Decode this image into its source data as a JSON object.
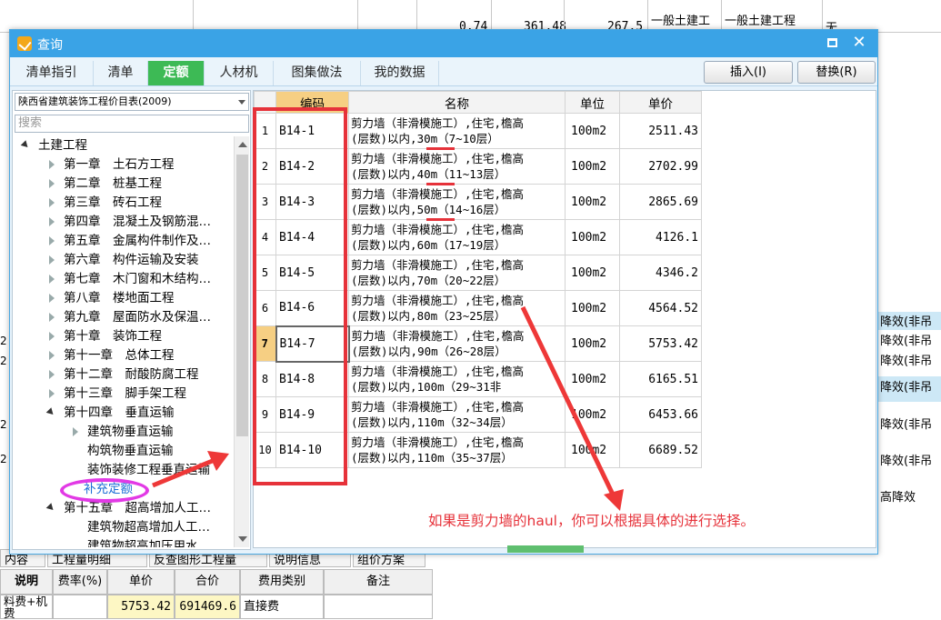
{
  "background": {
    "top_values": [
      "0.74",
      "361.48",
      "267.5",
      "一般土建工",
      "一般土建工程"
    ],
    "top_extra": "无",
    "right_rows": [
      "降效(非吊",
      "降效(非吊",
      "降效(非吊",
      "降效(非吊",
      "降效(非吊",
      "降效(非吊",
      "高降效"
    ],
    "left_digits": [
      "2",
      "2",
      "2",
      "2"
    ],
    "bottom_tabs": [
      "内容",
      "工程量明细",
      "反查图形工程量",
      "说明信息",
      "组价方案"
    ],
    "bottom_headers": [
      "说明",
      "费率(%)",
      "单价",
      "合价",
      "费用类别",
      "备注"
    ],
    "bottom_row": [
      "料费+机",
      "费",
      "5753.42",
      "691469.6",
      "直接费"
    ]
  },
  "dialog": {
    "title": "查询",
    "tabs": [
      "清单指引",
      "清单",
      "定额",
      "人材机",
      "图集做法",
      "我的数据"
    ],
    "active_tab": "定额",
    "insert_button": "插入(I)",
    "replace_button": "替换(R)"
  },
  "left_panel": {
    "library": "陕西省建筑装饰工程价目表(2009)",
    "search_placeholder": "搜索",
    "tree": [
      {
        "label": "土建工程",
        "level": 0,
        "state": "open"
      },
      {
        "label": "第一章　土石方工程",
        "level": 1,
        "state": "closed"
      },
      {
        "label": "第二章　桩基工程",
        "level": 1,
        "state": "closed"
      },
      {
        "label": "第三章　砖石工程",
        "level": 1,
        "state": "closed"
      },
      {
        "label": "第四章　混凝土及钢筋混…",
        "level": 1,
        "state": "closed"
      },
      {
        "label": "第五章　金属构件制作及…",
        "level": 1,
        "state": "closed"
      },
      {
        "label": "第六章　构件运输及安装",
        "level": 1,
        "state": "closed"
      },
      {
        "label": "第七章　木门窗和木结构…",
        "level": 1,
        "state": "closed"
      },
      {
        "label": "第八章　楼地面工程",
        "level": 1,
        "state": "closed"
      },
      {
        "label": "第九章　屋面防水及保温…",
        "level": 1,
        "state": "closed"
      },
      {
        "label": "第十章　装饰工程",
        "level": 1,
        "state": "closed"
      },
      {
        "label": "第十一章　总体工程",
        "level": 1,
        "state": "closed"
      },
      {
        "label": "第十二章　耐酸防腐工程",
        "level": 1,
        "state": "closed"
      },
      {
        "label": "第十三章　脚手架工程",
        "level": 1,
        "state": "closed"
      },
      {
        "label": "第十四章　垂直运输",
        "level": 1,
        "state": "open"
      },
      {
        "label": "建筑物垂直运输",
        "level": 2,
        "state": "closed"
      },
      {
        "label": "构筑物垂直运输",
        "level": 2,
        "state": "none"
      },
      {
        "label": "装饰装修工程垂直运输",
        "level": 2,
        "state": "none"
      },
      {
        "label": "补充定额",
        "level": 2,
        "state": "highlight"
      },
      {
        "label": "第十五章　超高增加人工…",
        "level": 1,
        "state": "open"
      },
      {
        "label": "建筑物超高增加人工…",
        "level": 2,
        "state": "none"
      },
      {
        "label": "建筑物超高加压用水…",
        "level": 2,
        "state": "none"
      }
    ]
  },
  "grid": {
    "headers": [
      "",
      "编码",
      "名称",
      "单位",
      "单价"
    ],
    "rows": [
      {
        "num": "1",
        "code": "B14-1",
        "name1": "剪力墙（非滑模施工）,住宅,檐高",
        "name2": "(层数)以内,30m（7~10层）",
        "unit": "100m2",
        "price": "2511.43"
      },
      {
        "num": "2",
        "code": "B14-2",
        "name1": "剪力墙（非滑模施工）,住宅,檐高",
        "name2": "(层数)以内,40m（11~13层）",
        "unit": "100m2",
        "price": "2702.99"
      },
      {
        "num": "3",
        "code": "B14-3",
        "name1": "剪力墙（非滑模施工）,住宅,檐高",
        "name2": "(层数)以内,50m（14~16层）",
        "unit": "100m2",
        "price": "2865.69"
      },
      {
        "num": "4",
        "code": "B14-4",
        "name1": "剪力墙（非滑模施工）,住宅,檐高",
        "name2": "(层数)以内,60m（17~19层）",
        "unit": "100m2",
        "price": "4126.1"
      },
      {
        "num": "5",
        "code": "B14-5",
        "name1": "剪力墙（非滑模施工）,住宅,檐高",
        "name2": "(层数)以内,70m（20~22层）",
        "unit": "100m2",
        "price": "4346.2"
      },
      {
        "num": "6",
        "code": "B14-6",
        "name1": "剪力墙（非滑模施工）,住宅,檐高",
        "name2": "(层数)以内,80m（23~25层）",
        "unit": "100m2",
        "price": "4564.52"
      },
      {
        "num": "7",
        "code": "B14-7",
        "name1": "剪力墙（非滑模施工）,住宅,檐高",
        "name2": "(层数)以内,90m（26~28层）",
        "unit": "100m2",
        "price": "5753.42"
      },
      {
        "num": "8",
        "code": "B14-8",
        "name1": "剪力墙（非滑模施工）,住宅,檐高",
        "name2": "(层数)以内,100m（29~31非",
        "unit": "100m2",
        "price": "6165.51"
      },
      {
        "num": "9",
        "code": "B14-9",
        "name1": "剪力墙（非滑模施工）,住宅,檐高",
        "name2": "(层数)以内,110m（32~34层）",
        "unit": "100m2",
        "price": "6453.66"
      },
      {
        "num": "10",
        "code": "B14-10",
        "name1": "剪力墙（非滑模施工）,住宅,檐高",
        "name2": "(层数)以内,110m（35~37层）",
        "unit": "100m2",
        "price": "6689.52"
      }
    ],
    "current_row": 7
  },
  "annotation": {
    "note": "如果是剪力墙的haul，你可以根据具体的进行选择。",
    "accent": "#e6323a"
  }
}
